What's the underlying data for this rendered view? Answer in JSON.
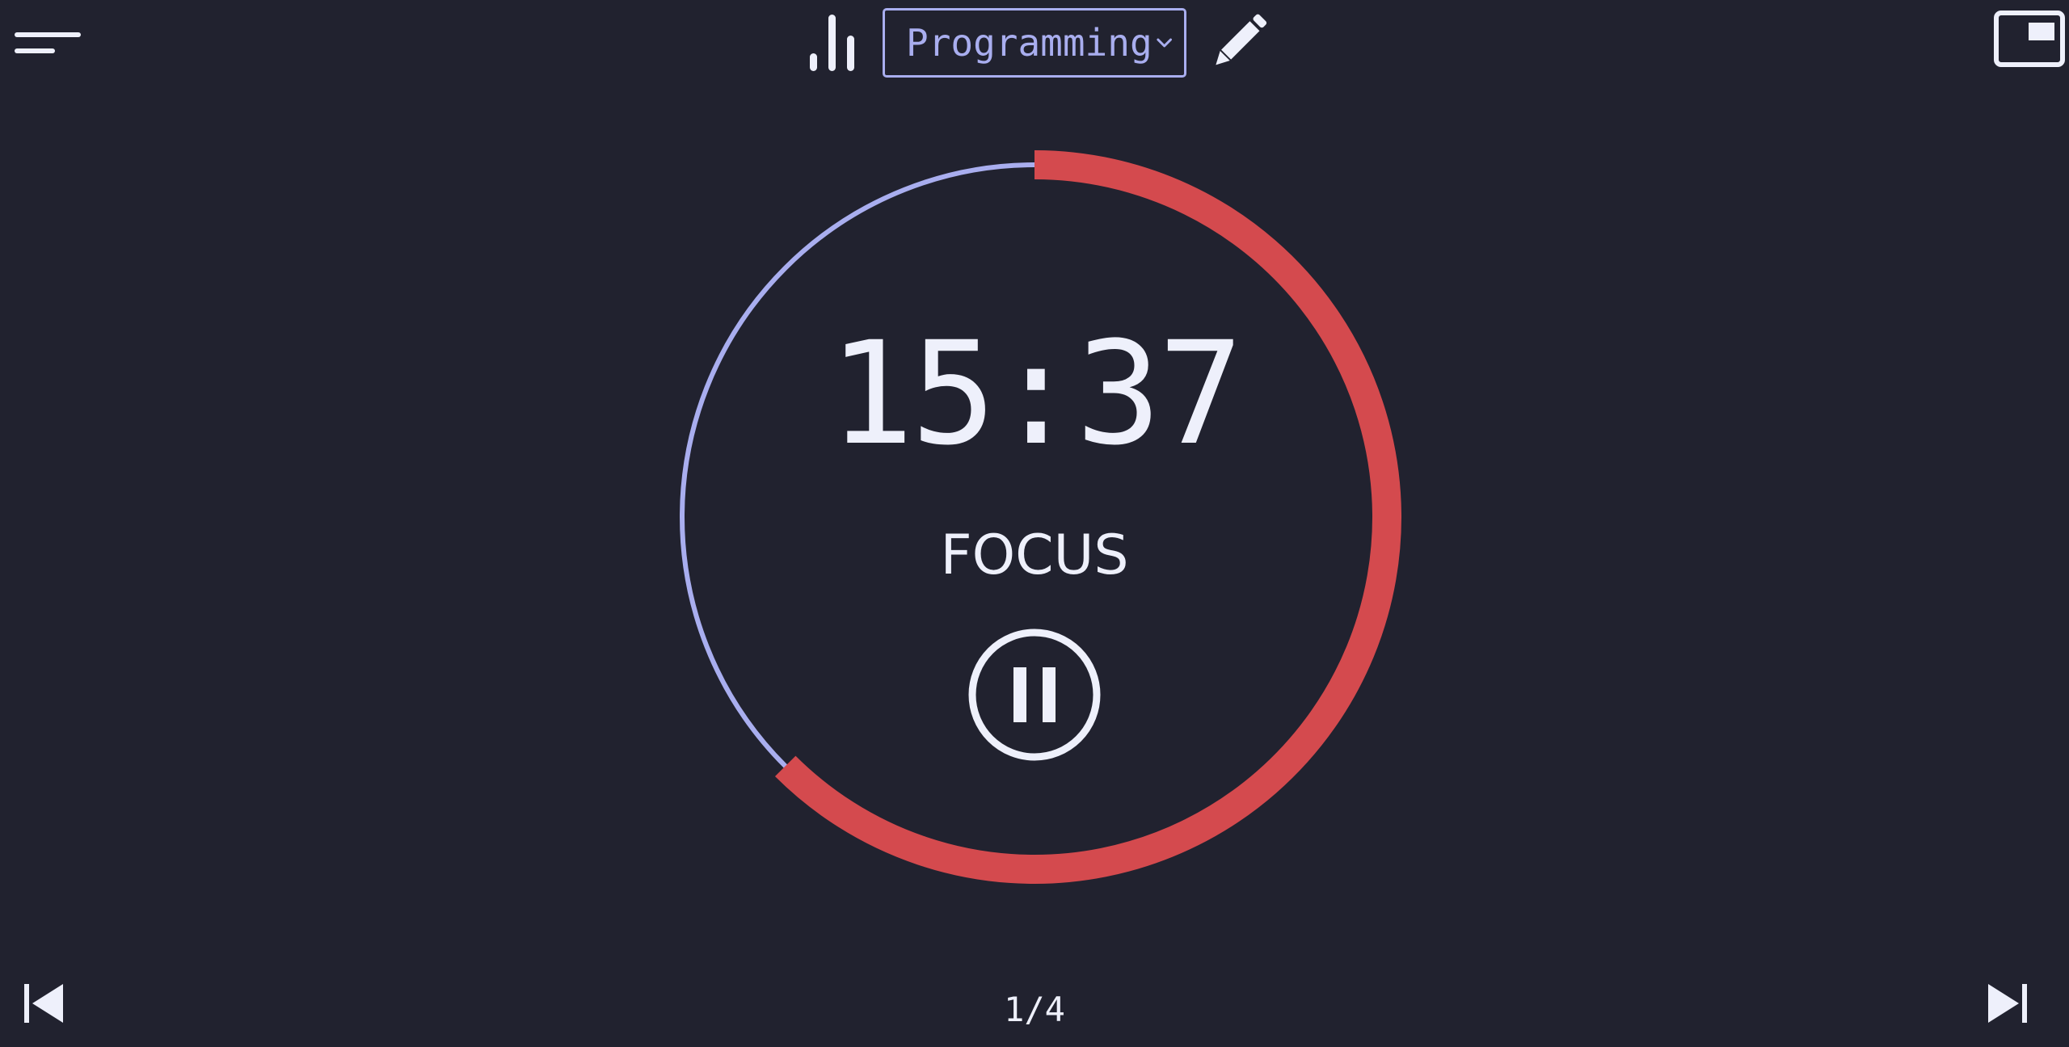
{
  "header": {
    "project": {
      "selected": "Programming"
    },
    "icons": {
      "menu": "hamburger-menu-icon",
      "stats": "bar-chart-icon",
      "dropdown": "chevron-down-icon",
      "edit": "pencil-icon",
      "pip": "picture-in-picture-icon"
    }
  },
  "timer": {
    "time": "15:37",
    "mode": "FOCUS",
    "remaining_fraction": 0.625,
    "pause_icon": "pause-icon"
  },
  "footer": {
    "session": "1/4",
    "prev_icon": "skip-previous-icon",
    "next_icon": "skip-next-icon"
  },
  "colors": {
    "background": "#21222f",
    "foreground": "#eef0fb",
    "accent": "#a9aeef",
    "progress": "#d44a4e"
  }
}
